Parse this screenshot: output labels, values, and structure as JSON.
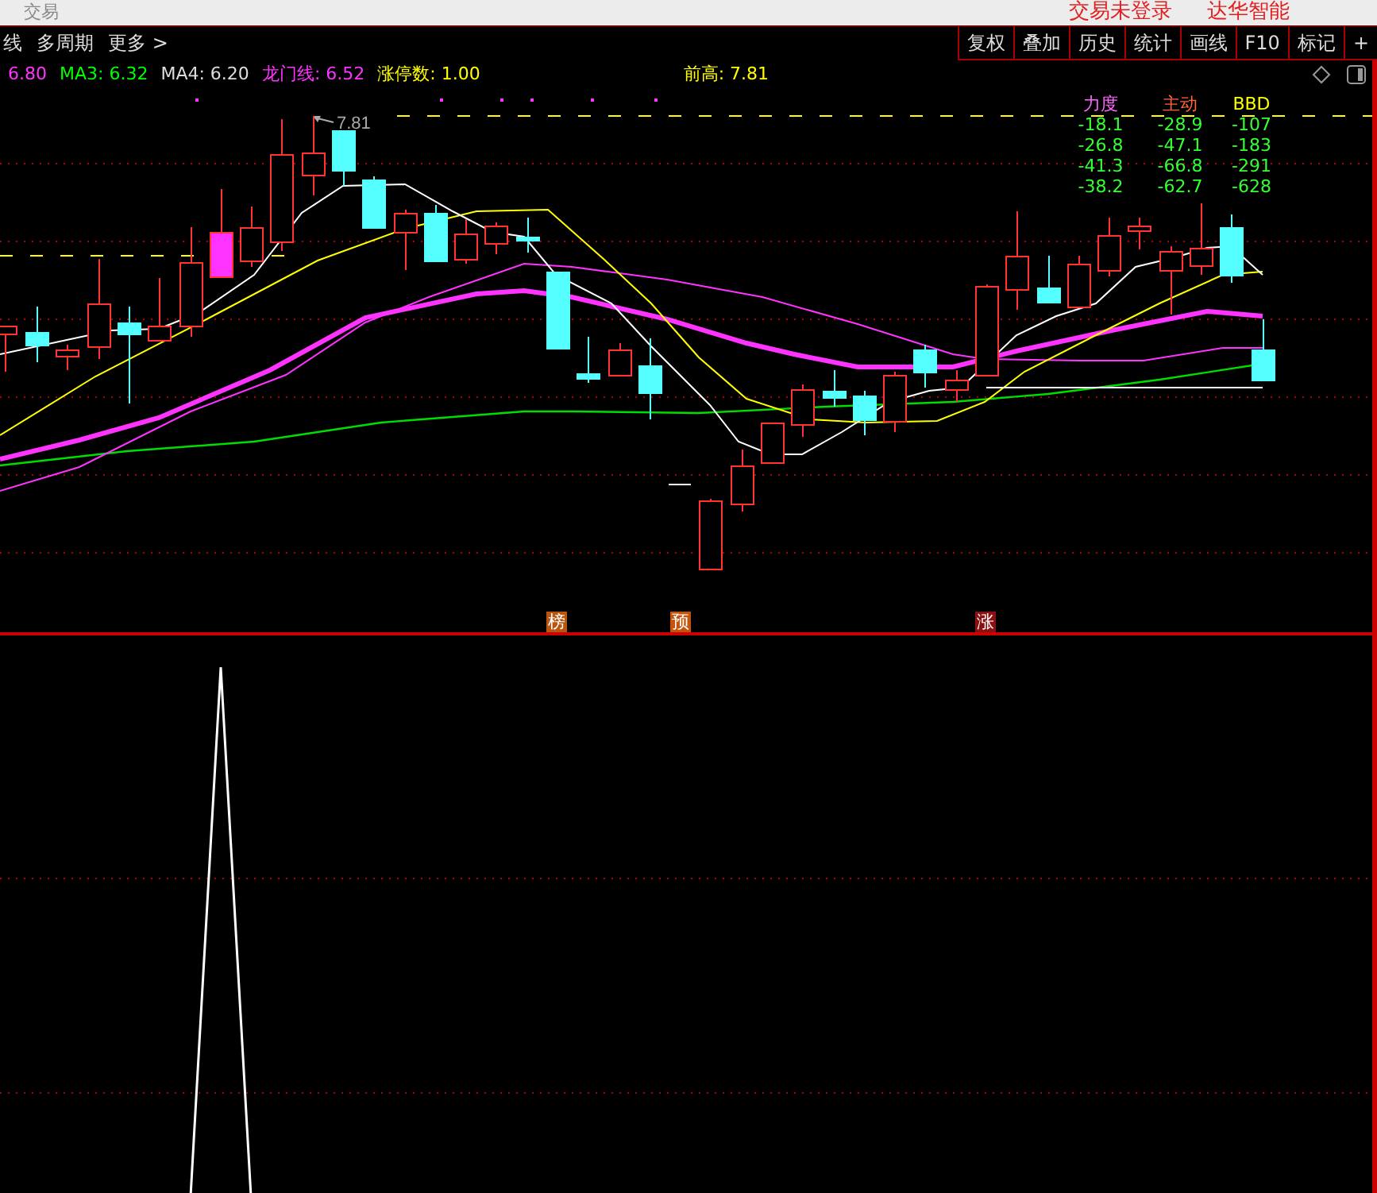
{
  "top_bar": {
    "title": "交易",
    "login_status": "交易未登录",
    "stock_name": "达华智能"
  },
  "toolbar": {
    "left_items": [
      "线",
      "多周期",
      "更多 >"
    ],
    "buttons": [
      "复权",
      "叠加",
      "历史",
      "统计",
      "画线",
      "F10",
      "标记",
      "+"
    ]
  },
  "indicators": [
    {
      "label": "6.80",
      "color": "#ff33ff"
    },
    {
      "label": "MA3: 6.32",
      "color": "#00ff00"
    },
    {
      "label": "MA4: 6.20",
      "color": "#dddddd"
    },
    {
      "label": "龙门线: 6.52",
      "color": "#ff33ff"
    },
    {
      "label": "涨停数: 1.00",
      "color": "#ffff00"
    }
  ],
  "previous_high": "前高: 7.81",
  "price_label": "7.81",
  "flow_table": {
    "columns": [
      {
        "label": "力度",
        "color": "#ff66ff"
      },
      {
        "label": "主动",
        "color": "#ff6633"
      },
      {
        "label": "BBD",
        "color": "#ffff00"
      }
    ],
    "rows": [
      [
        "-18.1",
        "-28.9",
        "-107"
      ],
      [
        "-26.8",
        "-47.1",
        "-183"
      ],
      [
        "-41.3",
        "-66.8",
        "-291"
      ],
      [
        "-38.2",
        "-62.7",
        "-628"
      ]
    ]
  },
  "signal_markers": [
    {
      "label": "榜",
      "color": "#b8560f"
    },
    {
      "label": "预",
      "color": "#c4540c"
    },
    {
      "label": "涨",
      "color": "#8b1010"
    }
  ]
}
